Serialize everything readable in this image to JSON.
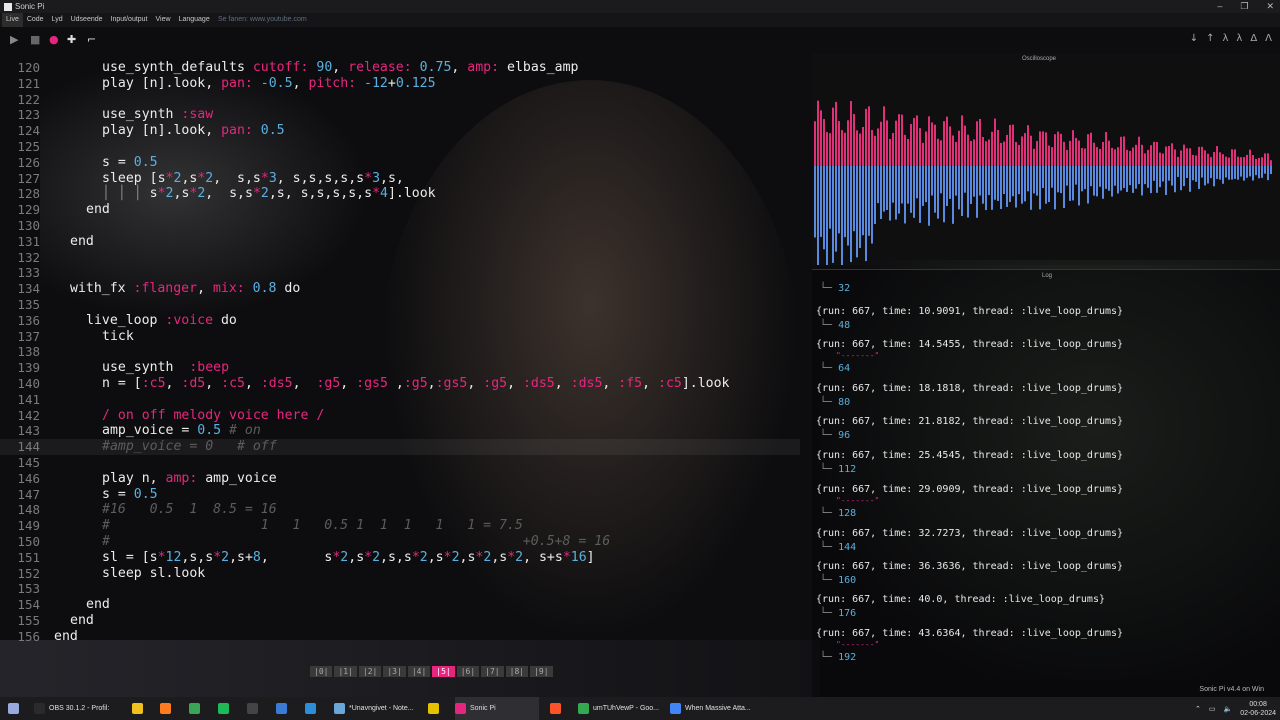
{
  "window": {
    "title": "Sonic Pi"
  },
  "menu": {
    "items": [
      "Live",
      "Code",
      "Lyd",
      "Udseende",
      "Input/output",
      "View",
      "Language"
    ],
    "overlay_chip": "",
    "overlay_text": "Se fanen: www.youtube.com"
  },
  "toolbar": {
    "play": "▶",
    "stop": "■",
    "rec": "●",
    "add": "✚",
    "size": "⌐",
    "right_icons": [
      "↓",
      "↑",
      "λ",
      "λ",
      "Δ",
      "Λ"
    ]
  },
  "editor": {
    "lines": [
      {
        "n": "120",
        "indent": 6,
        "parts": [
          [
            "kw",
            "use_synth_defaults "
          ],
          [
            "pk",
            "cutoff: "
          ],
          [
            "nm",
            "90"
          ],
          [
            "kw",
            ", "
          ],
          [
            "pk",
            "release: "
          ],
          [
            "nm",
            "0.75"
          ],
          [
            "kw",
            ", "
          ],
          [
            "pk",
            "amp: "
          ],
          [
            "kw",
            "elbas_amp"
          ]
        ]
      },
      {
        "n": "121",
        "indent": 6,
        "parts": [
          [
            "kw",
            "play [n].look, "
          ],
          [
            "pk",
            "pan: "
          ],
          [
            "nm",
            "-0.5"
          ],
          [
            "kw",
            ", "
          ],
          [
            "pk",
            "pitch: "
          ],
          [
            "nm",
            "-12"
          ],
          [
            "kw",
            "+"
          ],
          [
            "nm",
            "0.125"
          ]
        ]
      },
      {
        "n": "122",
        "indent": 0,
        "parts": []
      },
      {
        "n": "123",
        "indent": 6,
        "parts": [
          [
            "kw",
            "use_synth "
          ],
          [
            "pk",
            ":saw"
          ]
        ]
      },
      {
        "n": "124",
        "indent": 6,
        "parts": [
          [
            "kw",
            "play [n].look, "
          ],
          [
            "pk",
            "pan: "
          ],
          [
            "nm",
            "0.5"
          ]
        ]
      },
      {
        "n": "125",
        "indent": 0,
        "parts": []
      },
      {
        "n": "126",
        "indent": 6,
        "parts": [
          [
            "kw",
            "s = "
          ],
          [
            "nm",
            "0.5"
          ]
        ]
      },
      {
        "n": "127",
        "indent": 6,
        "parts": [
          [
            "kw",
            "sleep [s"
          ],
          [
            "pk",
            "*"
          ],
          [
            "nm",
            "2"
          ],
          [
            "kw",
            ",s"
          ],
          [
            "pk",
            "*"
          ],
          [
            "nm",
            "2"
          ],
          [
            "kw",
            ",  s,s"
          ],
          [
            "pk",
            "*"
          ],
          [
            "nm",
            "3"
          ],
          [
            "kw",
            ", s,s,s,s,s"
          ],
          [
            "pk",
            "*"
          ],
          [
            "nm",
            "3"
          ],
          [
            "kw",
            ",s,"
          ]
        ]
      },
      {
        "n": "128",
        "indent": 6,
        "parts": [
          [
            "cm2",
            "│ │ │ "
          ],
          [
            "kw",
            "s"
          ],
          [
            "pk",
            "*"
          ],
          [
            "nm",
            "2"
          ],
          [
            "kw",
            ",s"
          ],
          [
            "pk",
            "*"
          ],
          [
            "nm",
            "2"
          ],
          [
            "kw",
            ",  s,s"
          ],
          [
            "pk",
            "*"
          ],
          [
            "nm",
            "2"
          ],
          [
            "kw",
            ",s, s,s,s,s,s"
          ],
          [
            "pk",
            "*"
          ],
          [
            "nm",
            "4"
          ],
          [
            "kw",
            "].look"
          ]
        ]
      },
      {
        "n": "129",
        "indent": 4,
        "parts": [
          [
            "kw",
            "end"
          ]
        ]
      },
      {
        "n": "130",
        "indent": 0,
        "parts": []
      },
      {
        "n": "131",
        "indent": 2,
        "parts": [
          [
            "kw",
            "end"
          ]
        ]
      },
      {
        "n": "132",
        "indent": 0,
        "parts": []
      },
      {
        "n": "133",
        "indent": 0,
        "parts": []
      },
      {
        "n": "134",
        "indent": 2,
        "parts": [
          [
            "kw",
            "with_fx "
          ],
          [
            "pk",
            ":flanger"
          ],
          [
            "kw",
            ", "
          ],
          [
            "pk",
            "mix: "
          ],
          [
            "nm",
            "0.8"
          ],
          [
            "kw",
            " do"
          ]
        ]
      },
      {
        "n": "135",
        "indent": 0,
        "parts": []
      },
      {
        "n": "136",
        "indent": 4,
        "parts": [
          [
            "kw",
            "live_loop "
          ],
          [
            "pk",
            ":voice"
          ],
          [
            "kw",
            " do"
          ]
        ]
      },
      {
        "n": "137",
        "indent": 6,
        "parts": [
          [
            "kw",
            "tick"
          ]
        ]
      },
      {
        "n": "138",
        "indent": 0,
        "parts": []
      },
      {
        "n": "139",
        "indent": 6,
        "parts": [
          [
            "kw",
            "use_synth  "
          ],
          [
            "pk",
            ":beep"
          ]
        ]
      },
      {
        "n": "140",
        "indent": 6,
        "parts": [
          [
            "kw",
            "n = ["
          ],
          [
            "pk",
            ":c5"
          ],
          [
            "kw",
            ", "
          ],
          [
            "pk",
            ":d5"
          ],
          [
            "kw",
            ", "
          ],
          [
            "pk",
            ":c5"
          ],
          [
            "kw",
            ", "
          ],
          [
            "pk",
            ":ds5"
          ],
          [
            "kw",
            ",  "
          ],
          [
            "pk",
            ":g5"
          ],
          [
            "kw",
            ", "
          ],
          [
            "pk",
            ":gs5"
          ],
          [
            "kw",
            " ,"
          ],
          [
            "pk",
            ":g5"
          ],
          [
            "kw",
            ","
          ],
          [
            "pk",
            ":gs5"
          ],
          [
            "kw",
            ", "
          ],
          [
            "pk",
            ":g5"
          ],
          [
            "kw",
            ", "
          ],
          [
            "pk",
            ":ds5"
          ],
          [
            "kw",
            ", "
          ],
          [
            "pk",
            ":ds5"
          ],
          [
            "kw",
            ", "
          ],
          [
            "pk",
            ":f5"
          ],
          [
            "kw",
            ", "
          ],
          [
            "pk",
            ":c5"
          ],
          [
            "kw",
            "].look"
          ]
        ]
      },
      {
        "n": "141",
        "indent": 0,
        "parts": []
      },
      {
        "n": "142",
        "indent": 6,
        "parts": [
          [
            "pk",
            "/ on off melody voice here /"
          ]
        ]
      },
      {
        "n": "143",
        "indent": 6,
        "parts": [
          [
            "kw",
            "amp_voice = "
          ],
          [
            "nm",
            "0.5"
          ],
          [
            "cm",
            " # on"
          ]
        ]
      },
      {
        "n": "144",
        "indent": 6,
        "hl": true,
        "parts": [
          [
            "cm",
            "#amp_voice = 0   # off"
          ]
        ]
      },
      {
        "n": "145",
        "indent": 0,
        "parts": []
      },
      {
        "n": "146",
        "indent": 6,
        "parts": [
          [
            "kw",
            "play n, "
          ],
          [
            "pk",
            "amp: "
          ],
          [
            "kw",
            "amp_voice"
          ]
        ]
      },
      {
        "n": "147",
        "indent": 6,
        "parts": [
          [
            "kw",
            "s = "
          ],
          [
            "nm",
            "0.5"
          ]
        ]
      },
      {
        "n": "148",
        "indent": 6,
        "parts": [
          [
            "cm",
            "#16   0.5  1  8.5 = 16"
          ]
        ]
      },
      {
        "n": "149",
        "indent": 6,
        "parts": [
          [
            "cm",
            "#                   1   1   0.5 1  1  1   1   1 = 7.5"
          ]
        ]
      },
      {
        "n": "150",
        "indent": 6,
        "parts": [
          [
            "cm",
            "#                                                    +0.5+8 = 16"
          ]
        ]
      },
      {
        "n": "151",
        "indent": 6,
        "parts": [
          [
            "kw",
            "sl = [s"
          ],
          [
            "pk",
            "*"
          ],
          [
            "nm",
            "12"
          ],
          [
            "kw",
            ",s,s"
          ],
          [
            "pk",
            "*"
          ],
          [
            "nm",
            "2"
          ],
          [
            "kw",
            ",s+"
          ],
          [
            "nm",
            "8"
          ],
          [
            "kw",
            ",       s"
          ],
          [
            "pk",
            "*"
          ],
          [
            "nm",
            "2"
          ],
          [
            "kw",
            ",s"
          ],
          [
            "pk",
            "*"
          ],
          [
            "nm",
            "2"
          ],
          [
            "kw",
            ",s,s"
          ],
          [
            "pk",
            "*"
          ],
          [
            "nm",
            "2"
          ],
          [
            "kw",
            ",s"
          ],
          [
            "pk",
            "*"
          ],
          [
            "nm",
            "2"
          ],
          [
            "kw",
            ",s"
          ],
          [
            "pk",
            "*"
          ],
          [
            "nm",
            "2"
          ],
          [
            "kw",
            ",s"
          ],
          [
            "pk",
            "*"
          ],
          [
            "nm",
            "2"
          ],
          [
            "kw",
            ", s+s"
          ],
          [
            "pk",
            "*"
          ],
          [
            "nm",
            "16"
          ],
          [
            "kw",
            "]"
          ]
        ]
      },
      {
        "n": "152",
        "indent": 6,
        "parts": [
          [
            "kw",
            "sleep sl.look"
          ]
        ]
      },
      {
        "n": "153",
        "indent": 0,
        "parts": []
      },
      {
        "n": "154",
        "indent": 4,
        "parts": [
          [
            "kw",
            "end"
          ]
        ]
      },
      {
        "n": "155",
        "indent": 2,
        "parts": [
          [
            "kw",
            "end"
          ]
        ]
      },
      {
        "n": "156",
        "indent": 0,
        "parts": [
          [
            "kw",
            "end"
          ]
        ]
      }
    ]
  },
  "buffers": {
    "tabs": [
      "|0|",
      "|1|",
      "|2|",
      "|3|",
      "|4|",
      "|5|",
      "|6|",
      "|7|",
      "|8|",
      "|9|"
    ],
    "active": 5
  },
  "scope": {
    "label": "Oscilloscope"
  },
  "log": {
    "label": "Log",
    "first_value": "32",
    "entries": [
      {
        "text": "{run: 667, time: 10.9091, thread: :live_loop_drums}",
        "value": "48",
        "dash": false
      },
      {
        "text": "{run: 667, time: 14.5455, thread: :live_loop_drums}",
        "value": "64",
        "dash": true
      },
      {
        "text": "{run: 667, time: 18.1818, thread: :live_loop_drums}",
        "value": "80",
        "dash": false
      },
      {
        "text": "{run: 667, time: 21.8182, thread: :live_loop_drums}",
        "value": "96",
        "dash": false
      },
      {
        "text": "{run: 667, time: 25.4545, thread: :live_loop_drums}",
        "value": "112",
        "dash": false
      },
      {
        "text": "{run: 667, time: 29.0909, thread: :live_loop_drums}",
        "value": "128",
        "dash": true
      },
      {
        "text": "{run: 667, time: 32.7273, thread: :live_loop_drums}",
        "value": "144",
        "dash": false
      },
      {
        "text": "{run: 667, time: 36.3636, thread: :live_loop_drums}",
        "value": "160",
        "dash": false
      },
      {
        "text": "{run: 667, time: 40.0, thread: :live_loop_drums}",
        "value": "176",
        "dash": false
      },
      {
        "text": "{run: 667, time: 43.6364, thread: :live_loop_drums}",
        "value": "192",
        "dash": true
      }
    ],
    "dash_text": "\"-------\""
  },
  "version": "Sonic Pi v4.4 on Win",
  "taskbar": {
    "apps": [
      {
        "label": "OBS 30.1.2 - Profil:",
        "color": "#2a2a2a"
      },
      {
        "label": "",
        "color": "#f0c020"
      },
      {
        "label": "",
        "color": "#ff7b20"
      },
      {
        "label": "",
        "color": "#3aa655"
      },
      {
        "label": "",
        "color": "#1db954"
      },
      {
        "label": "",
        "color": "#444"
      },
      {
        "label": "",
        "color": "#3a7bd5"
      },
      {
        "label": "",
        "color": "#2a8fd8"
      },
      {
        "label": "*Unavngivet - Note...",
        "color": "#6aa6d8"
      },
      {
        "label": "",
        "color": "#e5c100"
      },
      {
        "label": "Sonic Pi",
        "color": "#e6267e"
      },
      {
        "label": "",
        "color": "#fb542b"
      },
      {
        "label": "umTUhVewP - Goo...",
        "color": "#34a853"
      },
      {
        "label": "When Massive Atta...",
        "color": "#4285f4"
      }
    ],
    "time": "00:08",
    "date": "02-06-2024"
  },
  "colors": {
    "accent": "#e6267e",
    "number": "#5ab0e0",
    "wave_top": "#e0307a",
    "wave_bottom": "#5a8ae0"
  }
}
